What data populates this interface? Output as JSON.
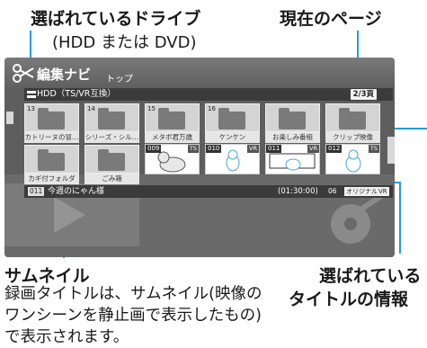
{
  "callouts": {
    "drive_title": "選ばれているドライブ",
    "drive_sub": "(HDD または DVD)",
    "page_title": "現在のページ",
    "thumbnail_title": "サムネイル",
    "thumbnail_desc": "録画タイトルは、サムネイル(映像のワンシーンを静止画で表示したもの)で表示されます。",
    "selected_info_line1": "選ばれている",
    "selected_info_line2": "タイトルの情報"
  },
  "screen": {
    "app_title": "編集ナビ",
    "breadcrumb": "トップ",
    "drive_label": "HDD（TS/VR互換）",
    "page_indicator": "2/3頁",
    "folder_row": [
      {
        "num": "13",
        "label": "カトリーヌの冒…"
      },
      {
        "num": "14",
        "label": "シリーズ・シル…"
      },
      {
        "num": "15",
        "label": "メタボ君万歳"
      },
      {
        "num": "16",
        "label": "ケンケン"
      },
      {
        "num": "",
        "label": "お楽しみ番組",
        "icon": "tv-folder-icon"
      },
      {
        "num": "",
        "label": "クリップ映像",
        "icon": "clip-folder-icon"
      }
    ],
    "special_row": [
      {
        "label": "カギ付フォルダ",
        "icon": "lock-folder-icon"
      },
      {
        "label": "ごみ箱",
        "icon": "trash-folder-icon"
      }
    ],
    "thumbnails": [
      {
        "num": "009",
        "tag": "TS"
      },
      {
        "num": "010",
        "tag": "VR"
      },
      {
        "num": "011",
        "tag": "VR"
      },
      {
        "num": "012",
        "tag": "TS"
      }
    ],
    "info": {
      "num": "011",
      "title": "今週のにゃん様",
      "duration": "(01:30:00)",
      "channel": "06",
      "tag_original": "オリジナル",
      "tag_format": "VR"
    }
  },
  "colors": {
    "accent": "#1ea0d8",
    "screen_bg": "#5e5e5e"
  }
}
